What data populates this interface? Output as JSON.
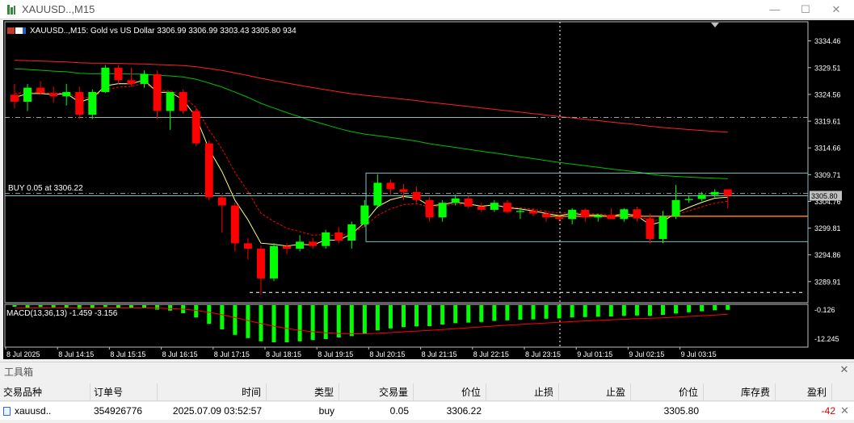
{
  "window": {
    "title": "XAUUSD..,M15",
    "minimize": "—",
    "maximize": "☐",
    "close": "✕"
  },
  "chart": {
    "info_line": "XAUUSD..,M15:  Gold vs US Dollar  3306.99 3306.99 3303.43 3305.80  934",
    "trade_label": "BUY 0.05 at 3306.22",
    "current_price_label": "3305.80",
    "macd_label": "MACD(13,36,13) -1.459 -3.156",
    "price_ticks": [
      "3334.46",
      "3329.51",
      "3324.56",
      "3319.61",
      "3314.66",
      "3309.71",
      "3304.76",
      "3299.81",
      "3294.86",
      "3289.91"
    ],
    "macd_ticks": [
      "-0.126",
      "-12.245"
    ],
    "time_ticks": [
      "8 Jul 2025",
      "8 Jul 14:15",
      "8 Jul 15:15",
      "8 Jul 16:15",
      "8 Jul 17:15",
      "8 Jul 18:15",
      "8 Jul 19:15",
      "8 Jul 20:15",
      "8 Jul 21:15",
      "8 Jul 22:15",
      "8 Jul 23:15",
      "9 Jul 01:15",
      "9 Jul 02:15",
      "9 Jul 03:15"
    ],
    "colors": {
      "background": "#000000",
      "bull": "#00ff00",
      "bear": "#ff0000",
      "macd_hist": "#00ff00",
      "macd_signal": "#ff0000",
      "ma_fast": "#ffff80",
      "ma_mid": "#00c000",
      "ma_slow": "#ff2020",
      "level_line": "#80c0c0",
      "orange_level": "#ff8000"
    }
  },
  "chart_data": {
    "type": "candlestick",
    "ylim": [
      3286,
      3338
    ],
    "candles": [
      {
        "o": 3324.5,
        "h": 3326.5,
        "l": 3322.0,
        "c": 3323.2
      },
      {
        "o": 3323.2,
        "h": 3326.5,
        "l": 3321.5,
        "c": 3325.8
      },
      {
        "o": 3325.8,
        "h": 3327.0,
        "l": 3324.5,
        "c": 3324.8
      },
      {
        "o": 3324.8,
        "h": 3326.0,
        "l": 3323.0,
        "c": 3324.2
      },
      {
        "o": 3324.2,
        "h": 3326.5,
        "l": 3322.5,
        "c": 3325.0
      },
      {
        "o": 3325.0,
        "h": 3326.0,
        "l": 3320.0,
        "c": 3320.8
      },
      {
        "o": 3320.8,
        "h": 3325.5,
        "l": 3320.0,
        "c": 3325.0
      },
      {
        "o": 3325.0,
        "h": 3330.0,
        "l": 3324.8,
        "c": 3329.5
      },
      {
        "o": 3329.5,
        "h": 3330.0,
        "l": 3326.5,
        "c": 3327.2
      },
      {
        "o": 3327.2,
        "h": 3329.5,
        "l": 3326.0,
        "c": 3326.5
      },
      {
        "o": 3326.5,
        "h": 3329.0,
        "l": 3325.8,
        "c": 3328.3
      },
      {
        "o": 3328.3,
        "h": 3329.0,
        "l": 3320.0,
        "c": 3321.5
      },
      {
        "o": 3321.5,
        "h": 3325.0,
        "l": 3318.0,
        "c": 3325.0
      },
      {
        "o": 3325.0,
        "h": 3325.5,
        "l": 3321.0,
        "c": 3321.5
      },
      {
        "o": 3321.5,
        "h": 3322.0,
        "l": 3315.0,
        "c": 3315.5
      },
      {
        "o": 3315.5,
        "h": 3316.0,
        "l": 3305.0,
        "c": 3305.5
      },
      {
        "o": 3305.5,
        "h": 3306.0,
        "l": 3299.0,
        "c": 3304.0
      },
      {
        "o": 3304.0,
        "h": 3304.5,
        "l": 3295.5,
        "c": 3297.0
      },
      {
        "o": 3297.0,
        "h": 3298.0,
        "l": 3294.0,
        "c": 3296.0
      },
      {
        "o": 3296.0,
        "h": 3296.5,
        "l": 3287.5,
        "c": 3290.5
      },
      {
        "o": 3290.5,
        "h": 3297.0,
        "l": 3290.0,
        "c": 3296.5
      },
      {
        "o": 3296.5,
        "h": 3297.0,
        "l": 3295.0,
        "c": 3296.0
      },
      {
        "o": 3296.0,
        "h": 3298.5,
        "l": 3295.5,
        "c": 3297.3
      },
      {
        "o": 3297.3,
        "h": 3298.0,
        "l": 3296.0,
        "c": 3296.5
      },
      {
        "o": 3296.5,
        "h": 3299.5,
        "l": 3296.0,
        "c": 3299.0
      },
      {
        "o": 3299.0,
        "h": 3300.0,
        "l": 3297.0,
        "c": 3297.5
      },
      {
        "o": 3297.5,
        "h": 3301.0,
        "l": 3296.0,
        "c": 3300.5
      },
      {
        "o": 3300.5,
        "h": 3305.0,
        "l": 3300.0,
        "c": 3304.0
      },
      {
        "o": 3304.0,
        "h": 3309.8,
        "l": 3303.5,
        "c": 3308.2
      },
      {
        "o": 3308.2,
        "h": 3308.8,
        "l": 3306.0,
        "c": 3307.0
      },
      {
        "o": 3307.0,
        "h": 3308.0,
        "l": 3305.0,
        "c": 3306.5
      },
      {
        "o": 3306.5,
        "h": 3307.5,
        "l": 3304.5,
        "c": 3305.0
      },
      {
        "o": 3305.0,
        "h": 3305.5,
        "l": 3301.0,
        "c": 3301.8
      },
      {
        "o": 3301.8,
        "h": 3305.0,
        "l": 3301.0,
        "c": 3304.5
      },
      {
        "o": 3304.5,
        "h": 3306.0,
        "l": 3304.0,
        "c": 3305.3
      },
      {
        "o": 3305.3,
        "h": 3305.8,
        "l": 3303.5,
        "c": 3303.8
      },
      {
        "o": 3303.8,
        "h": 3304.5,
        "l": 3302.8,
        "c": 3303.2
      },
      {
        "o": 3303.2,
        "h": 3305.0,
        "l": 3302.8,
        "c": 3304.5
      },
      {
        "o": 3304.5,
        "h": 3305.0,
        "l": 3302.5,
        "c": 3302.8
      },
      {
        "o": 3302.8,
        "h": 3303.5,
        "l": 3301.5,
        "c": 3303.0
      },
      {
        "o": 3303.0,
        "h": 3303.5,
        "l": 3302.0,
        "c": 3302.5
      },
      {
        "o": 3302.5,
        "h": 3303.0,
        "l": 3301.0,
        "c": 3301.8
      },
      {
        "o": 3301.8,
        "h": 3302.0,
        "l": 3301.0,
        "c": 3301.5
      },
      {
        "o": 3301.5,
        "h": 3303.5,
        "l": 3300.5,
        "c": 3303.2
      },
      {
        "o": 3303.2,
        "h": 3303.5,
        "l": 3301.0,
        "c": 3301.8
      },
      {
        "o": 3301.8,
        "h": 3302.5,
        "l": 3301.0,
        "c": 3302.2
      },
      {
        "o": 3302.2,
        "h": 3303.5,
        "l": 3301.5,
        "c": 3301.5
      },
      {
        "o": 3301.5,
        "h": 3303.5,
        "l": 3301.0,
        "c": 3303.3
      },
      {
        "o": 3303.3,
        "h": 3303.8,
        "l": 3301.0,
        "c": 3301.6
      },
      {
        "o": 3301.6,
        "h": 3302.5,
        "l": 3297.0,
        "c": 3297.8
      },
      {
        "o": 3297.8,
        "h": 3303.0,
        "l": 3297.0,
        "c": 3302.0
      },
      {
        "o": 3302.0,
        "h": 3307.8,
        "l": 3301.5,
        "c": 3305.0
      },
      {
        "o": 3305.0,
        "h": 3305.8,
        "l": 3304.5,
        "c": 3305.2
      },
      {
        "o": 3305.2,
        "h": 3306.5,
        "l": 3304.8,
        "c": 3306.0
      },
      {
        "o": 3306.0,
        "h": 3306.99,
        "l": 3305.5,
        "c": 3306.5
      },
      {
        "o": 3306.99,
        "h": 3306.99,
        "l": 3303.43,
        "c": 3305.8
      }
    ],
    "macd_hist": [
      -0.5,
      -0.8,
      -0.6,
      -0.7,
      -0.9,
      -1.2,
      -1.0,
      -0.6,
      -0.9,
      -0.9,
      -0.8,
      -1.4,
      -1.7,
      -2.5,
      -3.8,
      -5.8,
      -7.5,
      -9.2,
      -10.2,
      -11.2,
      -11.5,
      -11.5,
      -11.2,
      -10.8,
      -10.5,
      -10.0,
      -9.6,
      -8.8,
      -7.8,
      -7.2,
      -6.8,
      -6.6,
      -6.5,
      -6.0,
      -5.6,
      -5.4,
      -5.2,
      -4.9,
      -4.7,
      -4.5,
      -4.4,
      -4.2,
      -4.1,
      -3.8,
      -3.7,
      -3.6,
      -3.5,
      -3.3,
      -3.2,
      -3.3,
      -3.0,
      -2.6,
      -2.2,
      -1.9,
      -1.6,
      -1.459
    ],
    "levels": {
      "buy": 3306.22,
      "current": 3305.8,
      "upper_box": 3310.0,
      "orange": 3302.0,
      "lower_box": 3297.3,
      "top_dash": 3320.3,
      "bottom_dash": 3287.9
    }
  },
  "toolbox": {
    "title": "工具箱",
    "close": "✕",
    "columns": [
      "交易品种",
      "订单号",
      "时间",
      "类型",
      "交易量",
      "价位",
      "止损",
      "止盈",
      "价位",
      "库存费",
      "盈利"
    ],
    "row": {
      "symbol": "xauusd..",
      "order": "354926776",
      "time": "2025.07.09 03:52:57",
      "type": "buy",
      "volume": "0.05",
      "open_price": "3306.22",
      "sl": "",
      "tp": "",
      "price": "3305.80",
      "swap": "",
      "profit": "-42",
      "close": "✕"
    }
  }
}
